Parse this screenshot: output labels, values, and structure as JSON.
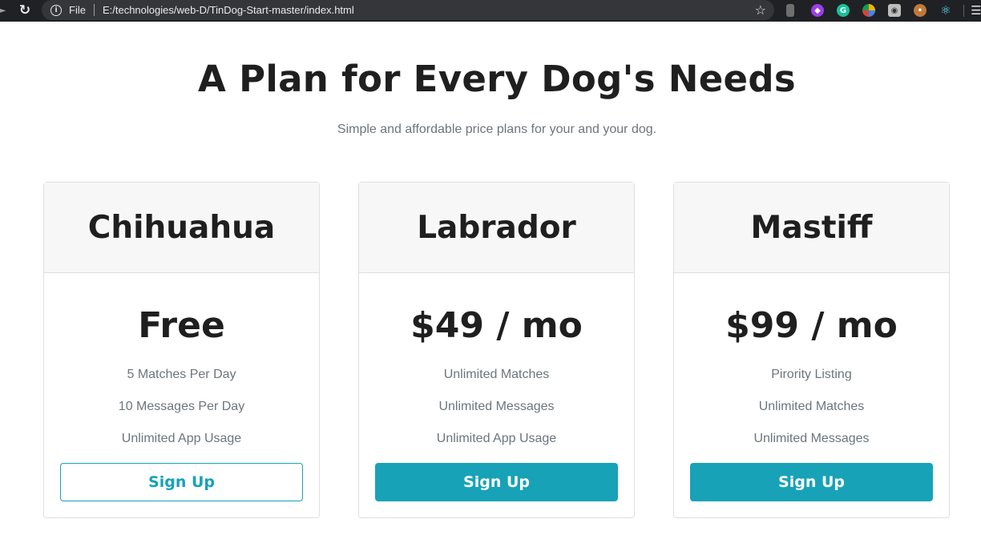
{
  "browser": {
    "scheme_label": "File",
    "url": "E:/technologies/web-D/TinDog-Start-master/index.html",
    "extension_icons": [
      "extension-puzzle-icon",
      "vpn-icon",
      "grammarly-icon",
      "color-picker-icon",
      "camera-icon",
      "cookie-icon",
      "react-devtools-icon"
    ]
  },
  "pricing": {
    "title": "A Plan for Every Dog's Needs",
    "subtitle": "Simple and affordable price plans for your and your dog.",
    "plans": [
      {
        "name": "Chihuahua",
        "price": "Free",
        "features": [
          "5 Matches Per Day",
          "10 Messages Per Day",
          "Unlimited App Usage"
        ],
        "button_label": "Sign Up",
        "button_style": "outline"
      },
      {
        "name": "Labrador",
        "price": "$49 / mo",
        "features": [
          "Unlimited Matches",
          "Unlimited Messages",
          "Unlimited App Usage"
        ],
        "button_label": "Sign Up",
        "button_style": "solid"
      },
      {
        "name": "Mastiff",
        "price": "$99 / mo",
        "features": [
          "Pirority Listing",
          "Unlimited Matches",
          "Unlimited Messages"
        ],
        "button_label": "Sign Up",
        "button_style": "solid"
      }
    ]
  },
  "colors": {
    "accent": "#17a2b8",
    "heading": "#1f1f1f",
    "muted_text": "#6c757d",
    "card_header_bg": "#f7f7f7",
    "toolbar_bg": "#202124"
  }
}
